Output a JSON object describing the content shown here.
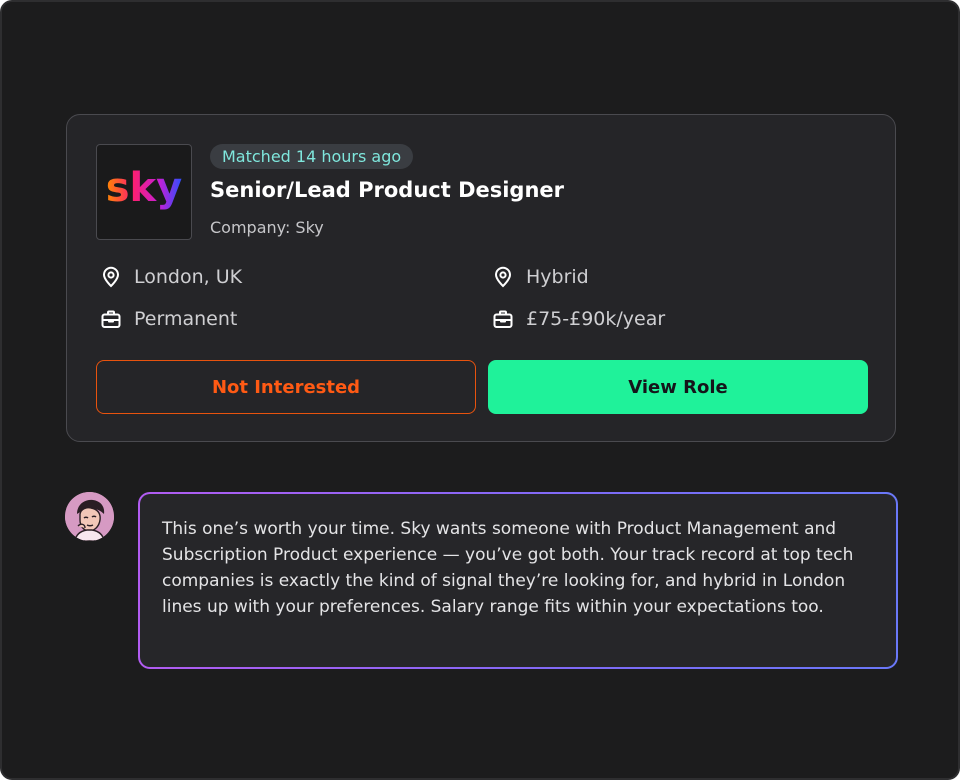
{
  "job": {
    "logo_text": "sky",
    "match_badge": "Matched 14 hours ago",
    "title": "Senior/Lead Product Designer",
    "company": "Company: Sky",
    "location": "London, UK",
    "work_mode": "Hybrid",
    "contract": "Permanent",
    "salary": "£75-£90k/year",
    "icons": {
      "location": "map-pin-icon",
      "work_mode": "map-pin-icon",
      "contract": "briefcase-icon",
      "salary": "briefcase-icon"
    }
  },
  "actions": {
    "not_interested_label": "Not Interested",
    "view_role_label": "View Role"
  },
  "assistant": {
    "avatar": "assistant-avatar",
    "message": "This one’s worth your time. Sky wants someone with Product Management and Subscription Product experience — you’ve got both. Your track record at top tech companies is exactly the kind of signal they’re looking for, and hybrid in London lines up with your preferences. Salary range fits within your expectations too."
  },
  "colors": {
    "background": "#1c1c1d",
    "card": "#252528",
    "accent_green": "#1ff29a",
    "accent_orange": "#ff5a14",
    "badge_text": "#7fe7dd",
    "message_border_start": "#b25cf2",
    "message_border_end": "#6a78f8"
  }
}
